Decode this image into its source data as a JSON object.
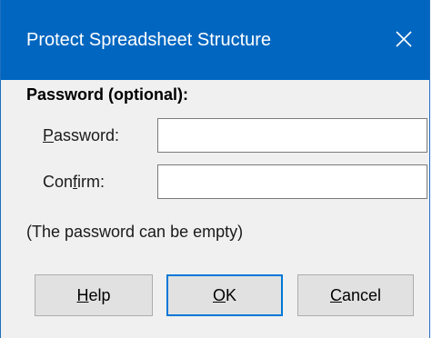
{
  "dialog": {
    "title": "Protect Spreadsheet Structure",
    "section_label": "Password (optional):",
    "password_label_mnemonic": "P",
    "password_label_rest": "assword:",
    "password_value": "",
    "confirm_label_pre": "Con",
    "confirm_label_mnemonic": "f",
    "confirm_label_rest": "irm:",
    "confirm_value": "",
    "hint": "(The password can be empty)",
    "help_mnemonic": "H",
    "help_rest": "elp",
    "ok_mnemonic": "O",
    "ok_rest": "K",
    "cancel_mnemonic": "C",
    "cancel_rest": "ancel"
  },
  "colors": {
    "titlebar": "#0066c0",
    "dialog_bg": "#f0f0f0",
    "default_button_border": "#0078d7"
  },
  "icons": {
    "close": "close-icon"
  }
}
